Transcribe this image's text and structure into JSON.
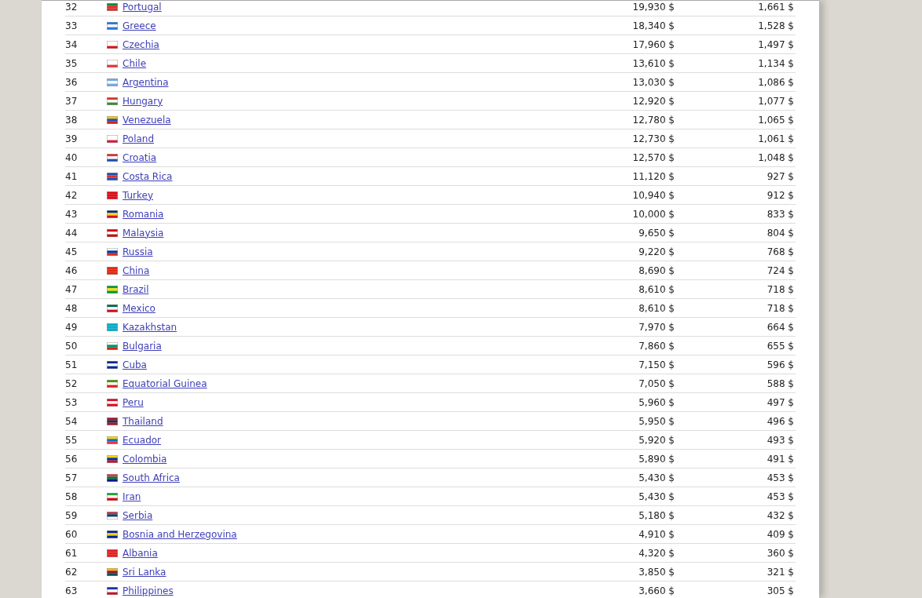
{
  "table": {
    "rows": [
      {
        "rank": "32",
        "country": "Portugal",
        "annual": "19,930 $",
        "monthly": "1,661 $"
      },
      {
        "rank": "33",
        "country": "Greece",
        "annual": "18,340 $",
        "monthly": "1,528 $"
      },
      {
        "rank": "34",
        "country": "Czechia",
        "annual": "17,960 $",
        "monthly": "1,497 $"
      },
      {
        "rank": "35",
        "country": "Chile",
        "annual": "13,610 $",
        "monthly": "1,134 $"
      },
      {
        "rank": "36",
        "country": "Argentina",
        "annual": "13,030 $",
        "monthly": "1,086 $"
      },
      {
        "rank": "37",
        "country": "Hungary",
        "annual": "12,920 $",
        "monthly": "1,077 $"
      },
      {
        "rank": "38",
        "country": "Venezuela",
        "annual": "12,780 $",
        "monthly": "1,065 $"
      },
      {
        "rank": "39",
        "country": "Poland",
        "annual": "12,730 $",
        "monthly": "1,061 $"
      },
      {
        "rank": "40",
        "country": "Croatia",
        "annual": "12,570 $",
        "monthly": "1,048 $"
      },
      {
        "rank": "41",
        "country": "Costa Rica",
        "annual": "11,120 $",
        "monthly": "927 $"
      },
      {
        "rank": "42",
        "country": "Turkey",
        "annual": "10,940 $",
        "monthly": "912 $"
      },
      {
        "rank": "43",
        "country": "Romania",
        "annual": "10,000 $",
        "monthly": "833 $"
      },
      {
        "rank": "44",
        "country": "Malaysia",
        "annual": "9,650 $",
        "monthly": "804 $"
      },
      {
        "rank": "45",
        "country": "Russia",
        "annual": "9,220 $",
        "monthly": "768 $"
      },
      {
        "rank": "46",
        "country": "China",
        "annual": "8,690 $",
        "monthly": "724 $"
      },
      {
        "rank": "47",
        "country": "Brazil",
        "annual": "8,610 $",
        "monthly": "718 $"
      },
      {
        "rank": "48",
        "country": "Mexico",
        "annual": "8,610 $",
        "monthly": "718 $"
      },
      {
        "rank": "49",
        "country": "Kazakhstan",
        "annual": "7,970 $",
        "monthly": "664 $"
      },
      {
        "rank": "50",
        "country": "Bulgaria",
        "annual": "7,860 $",
        "monthly": "655 $"
      },
      {
        "rank": "51",
        "country": "Cuba",
        "annual": "7,150 $",
        "monthly": "596 $"
      },
      {
        "rank": "52",
        "country": "Equatorial Guinea",
        "annual": "7,050 $",
        "monthly": "588 $"
      },
      {
        "rank": "53",
        "country": "Peru",
        "annual": "5,960 $",
        "monthly": "497 $"
      },
      {
        "rank": "54",
        "country": "Thailand",
        "annual": "5,950 $",
        "monthly": "496 $"
      },
      {
        "rank": "55",
        "country": "Ecuador",
        "annual": "5,920 $",
        "monthly": "493 $"
      },
      {
        "rank": "56",
        "country": "Colombia",
        "annual": "5,890 $",
        "monthly": "491 $"
      },
      {
        "rank": "57",
        "country": "South Africa",
        "annual": "5,430 $",
        "monthly": "453 $"
      },
      {
        "rank": "58",
        "country": "Iran",
        "annual": "5,430 $",
        "monthly": "453 $"
      },
      {
        "rank": "59",
        "country": "Serbia",
        "annual": "5,180 $",
        "monthly": "432 $"
      },
      {
        "rank": "60",
        "country": "Bosnia and Herzegovina",
        "annual": "4,910 $",
        "monthly": "409 $"
      },
      {
        "rank": "61",
        "country": "Albania",
        "annual": "4,320 $",
        "monthly": "360 $"
      },
      {
        "rank": "62",
        "country": "Sri Lanka",
        "annual": "3,850 $",
        "monthly": "321 $"
      },
      {
        "rank": "63",
        "country": "Philippines",
        "annual": "3,660 $",
        "monthly": "305 $"
      }
    ]
  }
}
